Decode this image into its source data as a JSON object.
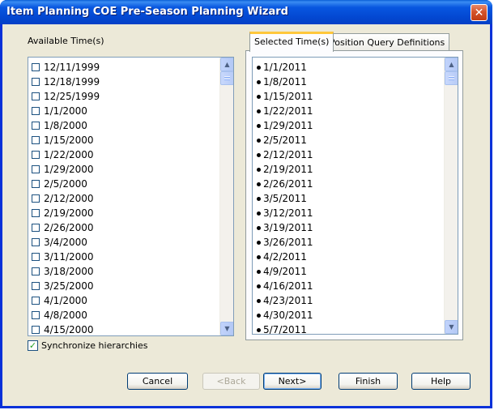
{
  "window": {
    "title": "Item Planning COE Pre-Season Planning Wizard",
    "close_glyph": "✕"
  },
  "available": {
    "label": "Available Time(s)",
    "items": [
      "12/11/1999",
      "12/18/1999",
      "12/25/1999",
      "1/1/2000",
      "1/8/2000",
      "1/15/2000",
      "1/22/2000",
      "1/29/2000",
      "2/5/2000",
      "2/12/2000",
      "2/19/2000",
      "2/26/2000",
      "3/4/2000",
      "3/11/2000",
      "3/18/2000",
      "3/25/2000",
      "4/1/2000",
      "4/8/2000",
      "4/15/2000"
    ]
  },
  "tabs": [
    {
      "label": "Selected Time(s)",
      "active": true
    },
    {
      "label": "Position Query Definitions",
      "active": false
    }
  ],
  "selected": {
    "items": [
      "1/1/2011",
      "1/8/2011",
      "1/15/2011",
      "1/22/2011",
      "1/29/2011",
      "2/5/2011",
      "2/12/2011",
      "2/19/2011",
      "2/26/2011",
      "3/5/2011",
      "3/12/2011",
      "3/19/2011",
      "3/26/2011",
      "4/2/2011",
      "4/9/2011",
      "4/16/2011",
      "4/23/2011",
      "4/30/2011",
      "5/7/2011"
    ]
  },
  "sync": {
    "label": "Synchronize hierarchies",
    "checked": true
  },
  "buttons": {
    "cancel": "Cancel",
    "back": "<Back",
    "next": "Next>",
    "finish": "Finish",
    "help": "Help"
  },
  "colors": {
    "titlebar": "#0348d2",
    "client": "#ece9d8",
    "tab_accent": "#ffc73c"
  }
}
